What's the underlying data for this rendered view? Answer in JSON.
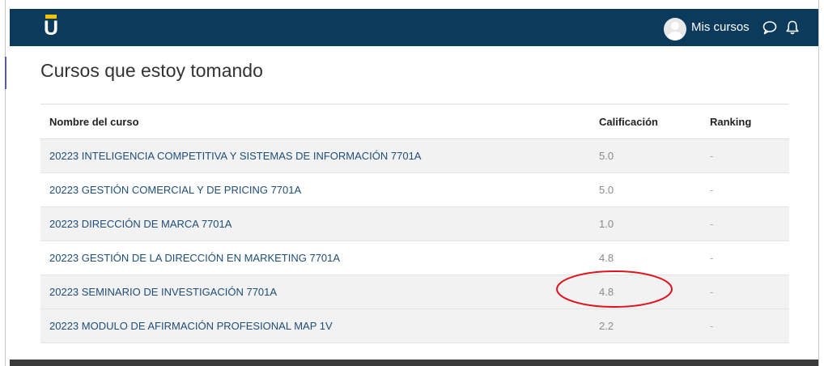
{
  "navbar": {
    "logo_text": "U",
    "user_menu_label": "Mis cursos",
    "icons": [
      "user-avatar",
      "chat-icon",
      "bell-icon"
    ],
    "background": "#0b3a5c",
    "accent": "#f5c400"
  },
  "page": {
    "title": "Cursos que estoy tomando"
  },
  "table": {
    "headers": {
      "course": "Nombre del curso",
      "grade": "Calificación",
      "ranking": "Ranking"
    },
    "rows": [
      {
        "course": "20223 INTELIGENCIA COMPETITIVA Y SISTEMAS DE INFORMACIÓN 7701A",
        "grade": "5.0",
        "ranking": "-"
      },
      {
        "course": "20223 GESTIÓN COMERCIAL Y DE PRICING 7701A",
        "grade": "5.0",
        "ranking": "-"
      },
      {
        "course": "20223 DIRECCIÓN DE MARCA 7701A",
        "grade": "1.0",
        "ranking": "-"
      },
      {
        "course": "20223 GESTIÓN DE LA DIRECCIÓN EN MARKETING 7701A",
        "grade": "4.8",
        "ranking": "-"
      },
      {
        "course": "20223 SEMINARIO DE INVESTIGACIÓN 7701A",
        "grade": "4.8",
        "ranking": "-"
      },
      {
        "course": "20223 MODULO DE AFIRMACIÓN PROFESIONAL MAP 1V",
        "grade": "2.2",
        "ranking": "-"
      }
    ]
  },
  "annotation": {
    "shape": "ellipse",
    "color": "#e0141e",
    "highlighted_row": 5
  }
}
